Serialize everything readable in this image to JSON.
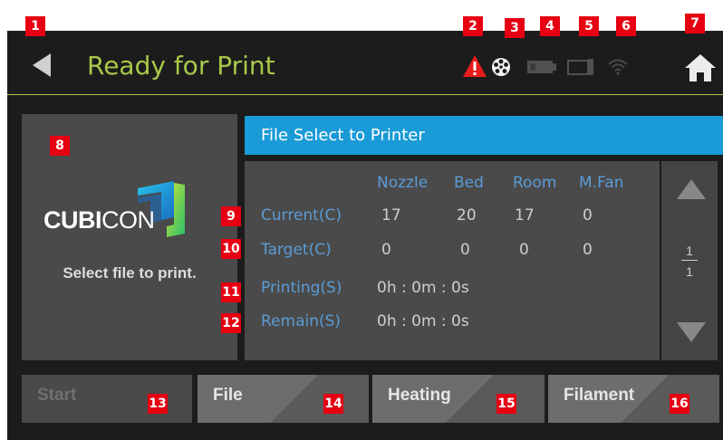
{
  "badges": [
    "1",
    "2",
    "3",
    "4",
    "5",
    "6",
    "7",
    "8",
    "9",
    "10",
    "11",
    "12",
    "13",
    "14",
    "15",
    "16"
  ],
  "header": {
    "title": "Ready for Print",
    "accent_color": "#a8c84a",
    "icons": [
      "back-icon",
      "warning-icon",
      "filament-reel-icon",
      "sd-card-icon",
      "usb-device-icon",
      "wifi-icon",
      "home-icon"
    ]
  },
  "left_panel": {
    "logo_text_bold": "CUBI",
    "logo_text_light": "CON",
    "select_text": "Select file to print."
  },
  "file_bar": {
    "label": "File Select to Printer",
    "color": "#1a9ad6"
  },
  "info": {
    "columns": [
      "Nozzle",
      "Bed",
      "Room",
      "M.Fan"
    ],
    "current_label": "Current(C)",
    "current_values": [
      "17",
      "20",
      "17",
      "0"
    ],
    "target_label": "Target(C)",
    "target_values": [
      "0",
      "0",
      "0",
      "0"
    ],
    "printing_label": "Printing(S)",
    "printing_value": "0h : 0m : 0s",
    "remain_label": "Remain(S)",
    "remain_value": "0h : 0m : 0s"
  },
  "pager": {
    "current": "1",
    "total": "1"
  },
  "buttons": {
    "start": "Start",
    "file": "File",
    "heating": "Heating",
    "filament": "Filament"
  }
}
